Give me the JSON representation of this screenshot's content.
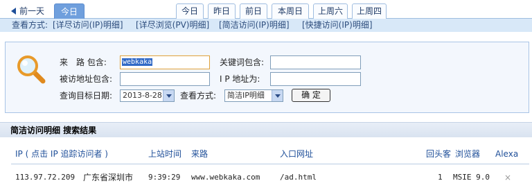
{
  "tabs": {
    "prev_day": "前一天",
    "today": "今日",
    "quick": [
      "今日",
      "昨日",
      "前日",
      "本周日",
      "上周六",
      "上周四"
    ]
  },
  "view_modes": {
    "label": "查看方式:",
    "options": [
      "[详尽访问(IP)明细]",
      "[详尽浏览(PV)明细]",
      "[简洁访问(IP)明细]",
      "[快捷访问(IP)明细]"
    ]
  },
  "search": {
    "source_label": "来　路 包含:",
    "source_value": "webkaka",
    "keyword_label": "关键词包含:",
    "keyword_value": "",
    "visited_label": "被访地址包含:",
    "visited_value": "",
    "ip_label": "I P 地址为:",
    "ip_value": "",
    "date_label": "查询目标日期:",
    "date_value": "2013-8-28",
    "mode_label": "查看方式:",
    "mode_value": "简洁IP明细",
    "confirm": "确 定"
  },
  "results": {
    "title": "简洁访问明细 搜索结果",
    "columns": [
      "IP ( 点击 IP 追踪访问者 )",
      "上站时间",
      "来路",
      "入口网址",
      "回头客",
      "浏览器",
      "Alexa"
    ],
    "rows": [
      {
        "ip": "113.97.72.209",
        "location": "广东省深圳市",
        "time": "9:39:29",
        "source": "www.webkaka.com",
        "entry": "/ad.html",
        "returning": "1",
        "browser": "MSIE 9.0",
        "alexa": "×"
      }
    ]
  }
}
